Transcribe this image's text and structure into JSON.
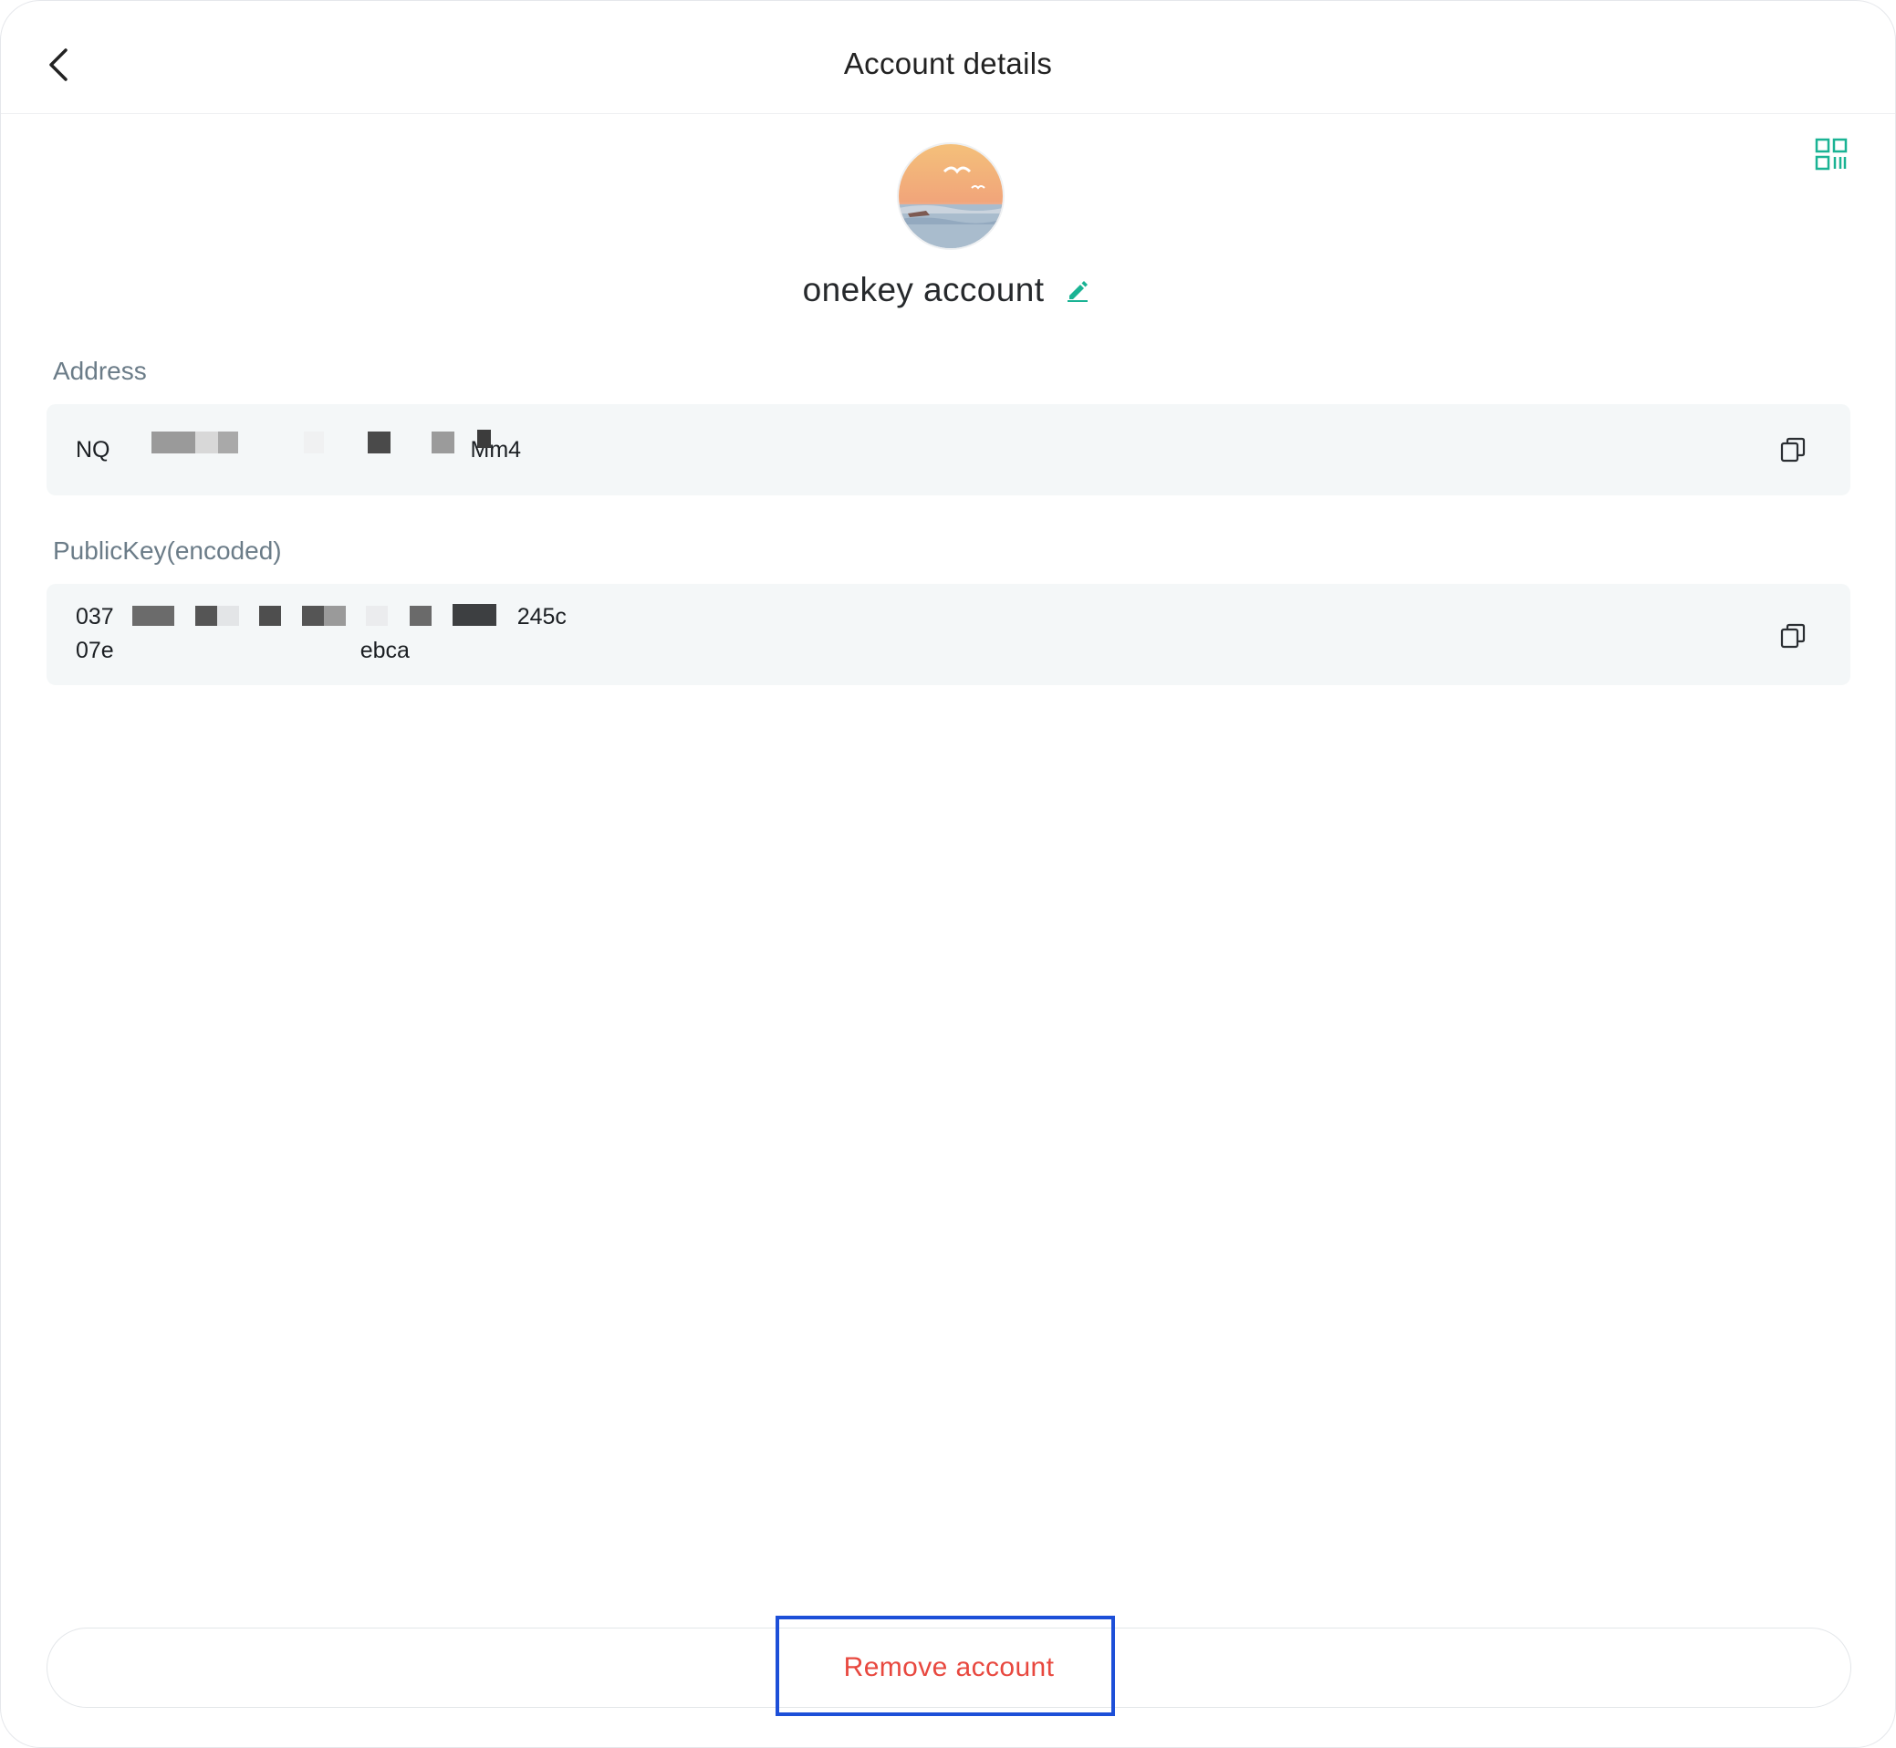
{
  "header": {
    "title": "Account details",
    "back_icon": "chevron-left-icon"
  },
  "qr_icon": "qr-code-icon",
  "account": {
    "name": "onekey account",
    "edit_icon": "pencil-icon",
    "avatar": "sunset-seagull-avatar"
  },
  "address": {
    "label": "Address",
    "value_prefix": "NQ",
    "value_suffix": "Mm4",
    "copy_icon": "copy-icon"
  },
  "public_key": {
    "label": "PublicKey(encoded)",
    "line1_prefix": "037",
    "line1_suffix": "245c",
    "line2_prefix": "07e",
    "line2_suffix": "ebca",
    "copy_icon": "copy-icon"
  },
  "footer": {
    "remove_label": "Remove account"
  },
  "colors": {
    "accent": "#1ab394",
    "danger": "#e8483f",
    "highlight": "#1d4fd8"
  }
}
